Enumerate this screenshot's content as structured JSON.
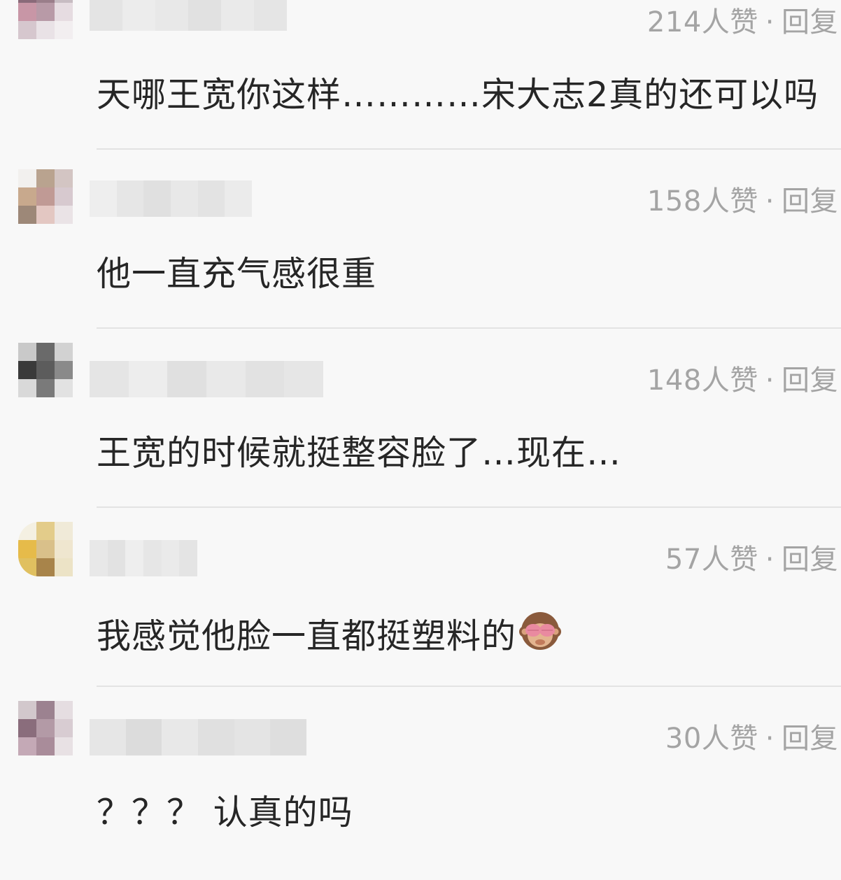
{
  "comments": [
    {
      "likes": "214人赞",
      "reply_label": "回复",
      "separator": "·",
      "text": "天哪王宽你这样…………宋大志2真的还可以吗",
      "avatar_colors": [
        "#8a6a79",
        "#9a7e8a",
        "#c7bcc2",
        "#c896a6",
        "#b89aa7",
        "#e6dce1",
        "#d6c7ce",
        "#e9e2e6",
        "#f2eef0"
      ],
      "name_colors": [
        "#e4e4e4",
        "#ececec",
        "#e8e8e8",
        "#e1e1e1",
        "#eaeaea",
        "#e5e5e5"
      ]
    },
    {
      "likes": "158人赞",
      "reply_label": "回复",
      "separator": "·",
      "text": "他一直充气感很重",
      "avatar_colors": [
        "#f2f0ee",
        "#b9a38f",
        "#d3c5c3",
        "#c8a98d",
        "#c09a95",
        "#d7c9cf",
        "#9d8878",
        "#e3c7c2",
        "#eae3e6"
      ],
      "name_colors": [
        "#eeeeee",
        "#e6e6e6",
        "#e0e0e0",
        "#e8e8e8",
        "#e3e3e3",
        "#ebebeb"
      ]
    },
    {
      "likes": "148人赞",
      "reply_label": "回复",
      "separator": "·",
      "text": "王宽的时候就挺整容脸了…现在…",
      "avatar_colors": [
        "#c9c9c9",
        "#6a6a6a",
        "#d2d2d2",
        "#3a3a3a",
        "#5c5c5c",
        "#8a8a8a",
        "#d9d9d9",
        "#7a7a7a",
        "#e2e2e2"
      ],
      "name_colors": [
        "#e5e5e5",
        "#ededed",
        "#e0e0e0",
        "#e9e9e9",
        "#e2e2e2",
        "#e6e6e6"
      ]
    },
    {
      "likes": "57人赞",
      "reply_label": "回复",
      "separator": "·",
      "text": "我感觉他脸一直都挺塑料的",
      "emoji": "see-no-evil-monkey",
      "avatar_colors": [
        "#f4f0e2",
        "#e3cc8a",
        "#f0ead8",
        "#e6bb4a",
        "#d9c08a",
        "#efe6cf",
        "#e0c060",
        "#a8844a",
        "#ece3c6"
      ],
      "name_colors": [
        "#e8e8e8",
        "#e2e2e2",
        "#eeeeee",
        "#e6e6e6",
        "#eaeaea",
        "#e4e4e4"
      ]
    },
    {
      "likes": "30人赞",
      "reply_label": "回复",
      "separator": "·",
      "text": "？？？ 认真的吗",
      "avatar_colors": [
        "#d2c8cc",
        "#9c8290",
        "#e5dde1",
        "#8a6d7c",
        "#b39aa6",
        "#d8ccd2",
        "#c4a9b6",
        "#a98c9a",
        "#e8e1e4"
      ],
      "name_colors": [
        "#e6e6e6",
        "#dcdcdc",
        "#e8e8e8",
        "#e0e0e0",
        "#e4e4e4",
        "#dedede"
      ]
    }
  ]
}
